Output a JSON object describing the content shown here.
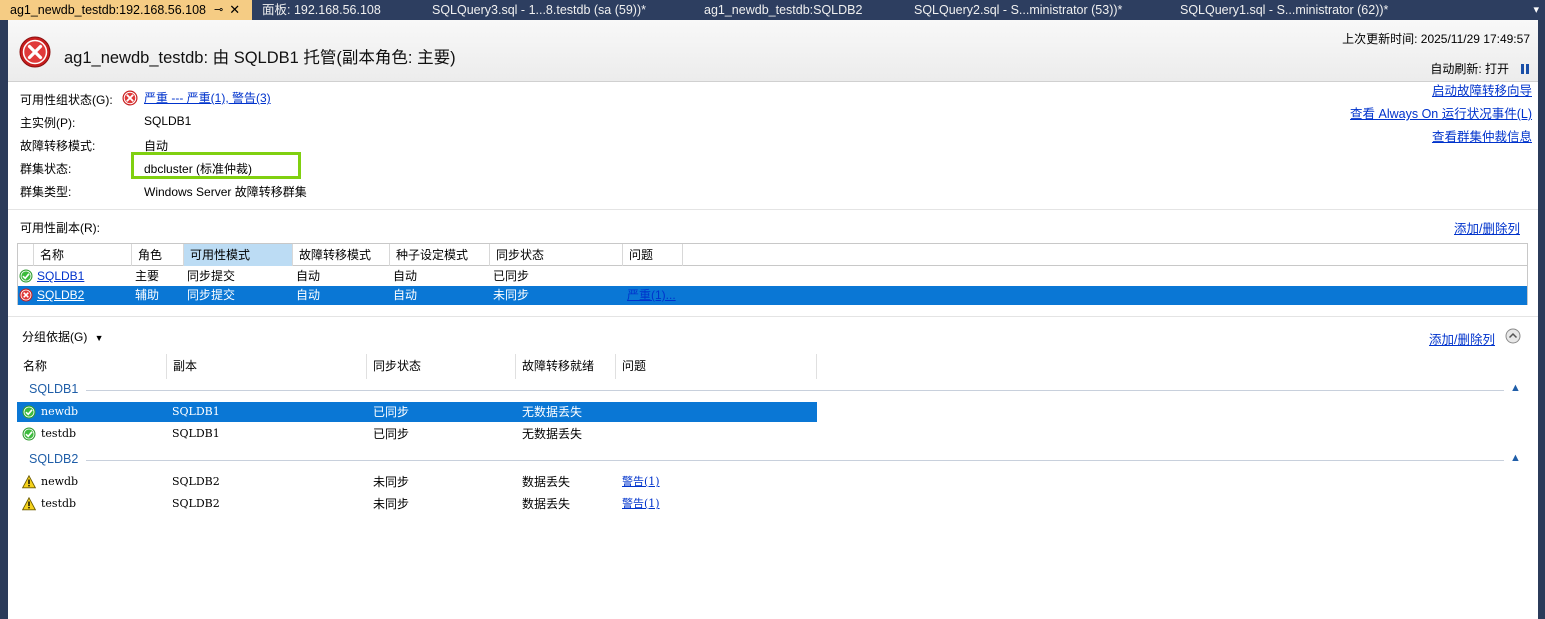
{
  "tabs": [
    {
      "label": "ag1_newdb_testdb:192.168.56.108",
      "active": true
    },
    {
      "label": "面板: 192.168.56.108",
      "active": false
    },
    {
      "label": "SQLQuery3.sql - 1...8.testdb (sa (59))*",
      "active": false
    },
    {
      "label": "ag1_newdb_testdb:SQLDB2",
      "active": false
    },
    {
      "label": "SQLQuery2.sql - S...ministrator (53))*",
      "active": false
    },
    {
      "label": "SQLQuery1.sql - S...ministrator (62))*",
      "active": false
    }
  ],
  "tab_dropdown": "▾",
  "header": {
    "title": "ag1_newdb_testdb: 由 SQLDB1 托管(副本角色: 主要)",
    "last_updated": "上次更新时间: 2025/11/29 17:49:57",
    "auto_refresh": "自动刷新: 打开"
  },
  "properties": {
    "ag_state_label": "可用性组状态(G):",
    "ag_state_link": "严重 --- 严重(1), 警告(3)",
    "primary_label": "主实例(P):",
    "primary_value": "SQLDB1",
    "failover_mode_label": "故障转移模式:",
    "failover_mode_value": "自动",
    "cluster_state_label": "群集状态:",
    "cluster_state_value": "dbcluster (标准仲裁)",
    "cluster_type_label": "群集类型:",
    "cluster_type_value": "Windows Server 故障转移群集"
  },
  "right_links": {
    "failover_wizard": "启动故障转移向导",
    "alwayson_events": "查看 Always On 运行状况事件(L)",
    "quorum_info": "查看群集仲裁信息"
  },
  "replicas": {
    "section_label": "可用性副本(R):",
    "add_remove": "添加/删除列",
    "columns": [
      "名称",
      "角色",
      "可用性模式",
      "故障转移模式",
      "种子设定模式",
      "同步状态",
      "问题"
    ],
    "rows": [
      {
        "status": "ok",
        "name": "SQLDB1",
        "role": "主要",
        "availability_mode": "同步提交",
        "failover_mode": "自动",
        "seeding_mode": "自动",
        "sync_state": "已同步",
        "issues": ""
      },
      {
        "status": "error",
        "name": "SQLDB2",
        "role": "辅助",
        "availability_mode": "同步提交",
        "failover_mode": "自动",
        "seeding_mode": "自动",
        "sync_state": "未同步",
        "issues": "严重(1)..."
      }
    ]
  },
  "databases": {
    "group_by_label": "分组依据(G)",
    "add_remove": "添加/删除列",
    "columns": [
      "名称",
      "副本",
      "同步状态",
      "故障转移就绪",
      "问题"
    ],
    "groups": [
      {
        "name": "SQLDB1",
        "rows": [
          {
            "status": "ok",
            "name": "newdb",
            "replica": "SQLDB1",
            "sync_state": "已同步",
            "failover_ready": "无数据丢失",
            "issues": ""
          },
          {
            "status": "ok",
            "name": "testdb",
            "replica": "SQLDB1",
            "sync_state": "已同步",
            "failover_ready": "无数据丢失",
            "issues": ""
          }
        ]
      },
      {
        "name": "SQLDB2",
        "rows": [
          {
            "status": "warning",
            "name": "newdb",
            "replica": "SQLDB2",
            "sync_state": "未同步",
            "failover_ready": "数据丢失",
            "issues": "警告(1)"
          },
          {
            "status": "warning",
            "name": "testdb",
            "replica": "SQLDB2",
            "sync_state": "未同步",
            "failover_ready": "数据丢失",
            "issues": "警告(1)"
          }
        ]
      }
    ]
  },
  "colors": {
    "accent_blue": "#0a77d5",
    "link": "#0033cc",
    "highlight_green": "#80d010",
    "tab_active": "#f5cc84"
  }
}
